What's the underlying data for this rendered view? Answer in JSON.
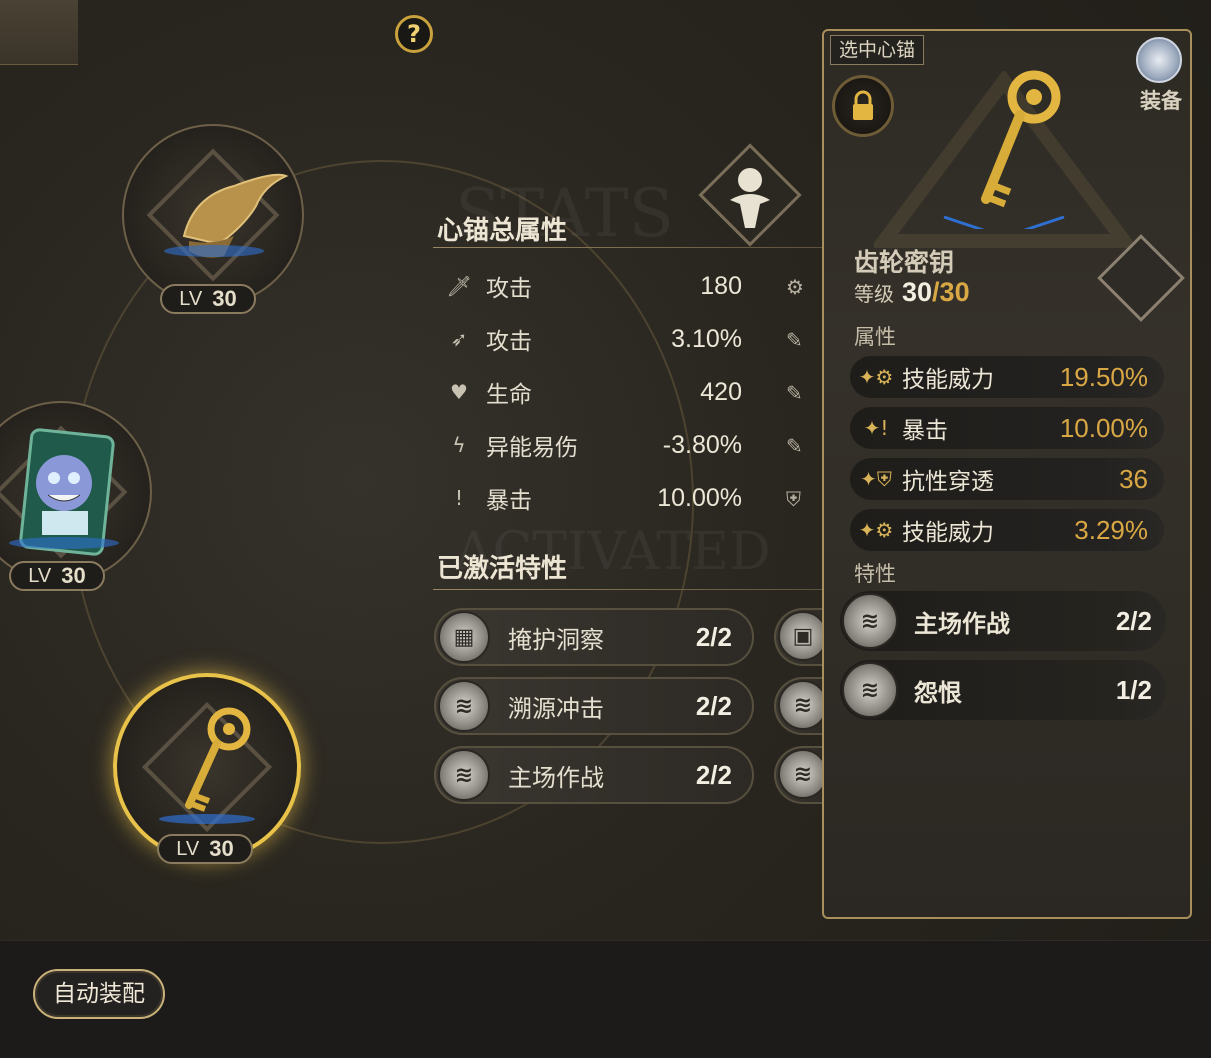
{
  "top": {
    "help_icon": "?"
  },
  "watermarks": {
    "stats": "STATS",
    "activated": "ACTIVATED"
  },
  "slots": [
    {
      "level_label": "LV",
      "level": "30",
      "item": "winged-ornament"
    },
    {
      "level_label": "LV",
      "level": "30",
      "item": "cheshire-cat-card"
    },
    {
      "level_label": "LV",
      "level": "30",
      "item": "gear-key",
      "selected": true
    }
  ],
  "stats_section": {
    "title": "心锚总属性",
    "rows": [
      {
        "icon": "sword-icon",
        "name": "攻击",
        "value": "180"
      },
      {
        "icon": "arrow-icon",
        "name": "攻击",
        "value": "3.10%"
      },
      {
        "icon": "heart-icon",
        "name": "生命",
        "value": "420"
      },
      {
        "icon": "lightning-icon",
        "name": "异能易伤",
        "value": "-3.80%"
      },
      {
        "icon": "crit-icon",
        "name": "暴击",
        "value": "10.00%"
      }
    ]
  },
  "traits_section": {
    "title": "已激活特性",
    "items": [
      {
        "name": "掩护洞察",
        "count": "2/2"
      },
      {
        "name": "溯源冲击",
        "count": "2/2"
      },
      {
        "name": "主场作战",
        "count": "2/2"
      }
    ]
  },
  "detail_panel": {
    "tag": "选中心锚",
    "equip_label": "装备",
    "item_name": "齿轮密钥",
    "level_label": "等级",
    "level_current": "30",
    "level_max": "/30",
    "attributes_label": "属性",
    "attributes": [
      {
        "icon": "skill-power-icon",
        "name": "技能威力",
        "value": "19.50%"
      },
      {
        "icon": "crit-icon",
        "name": "暴击",
        "value": "10.00%"
      },
      {
        "icon": "resist-pen-icon",
        "name": "抗性穿透",
        "value": "36"
      },
      {
        "icon": "skill-power-icon",
        "name": "技能威力",
        "value": "3.29%"
      }
    ],
    "traits_label": "特性",
    "traits": [
      {
        "name": "主场作战",
        "count": "2/2"
      },
      {
        "name": "怨恨",
        "count": "1/2"
      }
    ]
  },
  "auto_equip_label": "自动装配",
  "colors": {
    "gold": "#e9c24a",
    "value_gold": "#d9a845",
    "panel_border": "#a88f5c"
  }
}
